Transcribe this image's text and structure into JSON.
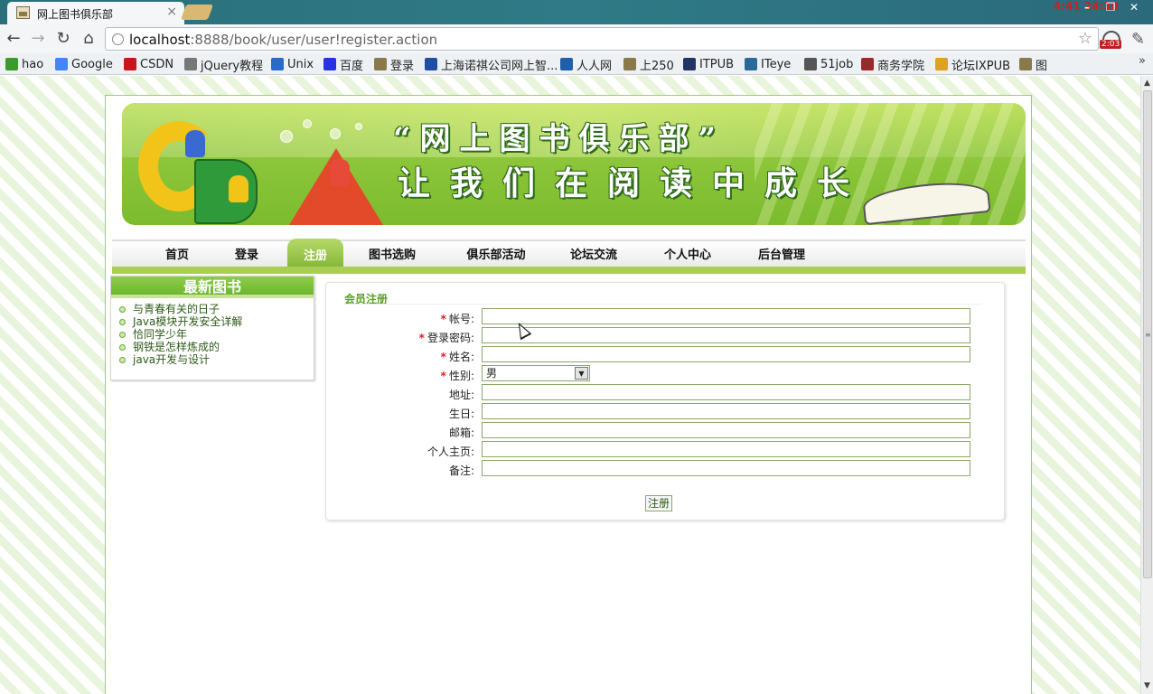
{
  "browser": {
    "tab_title": "网上图书俱乐部",
    "tab_close": "×",
    "url_host": "localhost",
    "url_rest": ":8888/book/user/user!register.action",
    "badge_text": "2:03",
    "window_controls": [
      "–",
      "❐",
      "✕"
    ],
    "clock_text": "4:41 24:30"
  },
  "bookmarks": [
    {
      "label": "hao",
      "icon": "hao-icon",
      "color": "#3a9a2a"
    },
    {
      "label": "Google",
      "icon": "google-icon",
      "color": "#4285f4"
    },
    {
      "label": "CSDN",
      "icon": "csdn-icon",
      "color": "#c8161d"
    },
    {
      "label": "jQuery教程",
      "icon": "globe-icon",
      "color": "#777777"
    },
    {
      "label": "Unix",
      "icon": "unix-icon",
      "color": "#2a6acc"
    },
    {
      "label": "百度",
      "icon": "baidu-icon",
      "color": "#2932e1"
    },
    {
      "label": "登录",
      "icon": "page-icon",
      "color": "#8a7a4a"
    },
    {
      "label": "上海诺祺公司网上智...",
      "icon": "td-icon",
      "color": "#1f4fa0"
    },
    {
      "label": "人人网",
      "icon": "renren-icon",
      "color": "#1f5faa"
    },
    {
      "label": "上250",
      "icon": "page-icon",
      "color": "#8a7a4a"
    },
    {
      "label": "ITPUB",
      "icon": "itpub-icon",
      "color": "#223366"
    },
    {
      "label": "ITeye",
      "icon": "iteye-icon",
      "color": "#2a6a9a"
    },
    {
      "label": "51job",
      "icon": "hand-icon",
      "color": "#555555"
    },
    {
      "label": "商务学院",
      "icon": "school-icon",
      "color": "#9a2a2a"
    },
    {
      "label": "论坛IXPUB",
      "icon": "ixpub-icon",
      "color": "#e0a020"
    },
    {
      "label": "图",
      "icon": "page-icon",
      "color": "#8a7a4a"
    }
  ],
  "bookmarks_more": "»",
  "banner": {
    "line1": "“网上图书俱乐部”",
    "line2": "让我们在阅读中成长"
  },
  "menu": [
    {
      "label": "首页",
      "active": false
    },
    {
      "label": "登录",
      "active": false
    },
    {
      "label": "注册",
      "active": true
    },
    {
      "label": "图书选购",
      "active": false
    },
    {
      "label": "俱乐部活动",
      "active": false
    },
    {
      "label": "论坛交流",
      "active": false
    },
    {
      "label": "个人中心",
      "active": false
    },
    {
      "label": "后台管理",
      "active": false
    }
  ],
  "sidebar": {
    "title": "最新图书",
    "books": [
      "与青春有关的日子",
      "Java模块开发安全详解",
      "恰同学少年",
      "钢铁是怎样炼成的",
      "java开发与设计"
    ]
  },
  "form": {
    "title": "会员注册",
    "required_mark": "*",
    "fields": [
      {
        "label": "帐号:",
        "required": true,
        "type": "text",
        "value": ""
      },
      {
        "label": "登录密码:",
        "required": true,
        "type": "password",
        "value": ""
      },
      {
        "label": "姓名:",
        "required": true,
        "type": "text",
        "value": ""
      },
      {
        "label": "性别:",
        "required": true,
        "type": "select",
        "value": "男"
      },
      {
        "label": "地址:",
        "required": false,
        "type": "text",
        "value": ""
      },
      {
        "label": "生日:",
        "required": false,
        "type": "text",
        "value": ""
      },
      {
        "label": "邮箱:",
        "required": false,
        "type": "text",
        "value": ""
      },
      {
        "label": "个人主页:",
        "required": false,
        "type": "text",
        "value": ""
      },
      {
        "label": "备注:",
        "required": false,
        "type": "text",
        "value": ""
      }
    ],
    "submit_label": "注册"
  },
  "colors": {
    "accent_green": "#6db62e",
    "required_red": "#e01b1b",
    "menu_bar_green": "#a9cf52"
  }
}
